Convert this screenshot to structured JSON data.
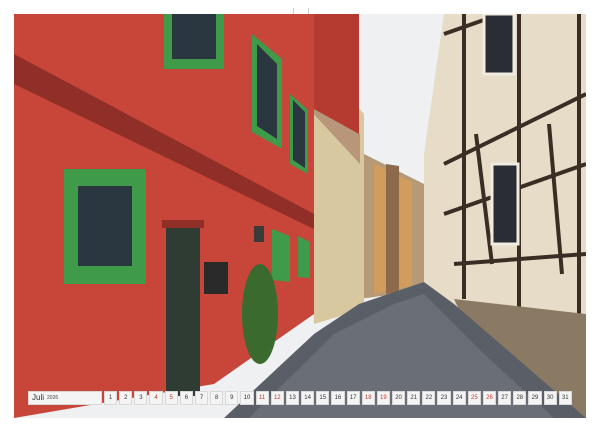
{
  "calendar": {
    "month": "Juli",
    "year": "2026",
    "weekend_color": "#c0392b",
    "days": [
      {
        "n": "1",
        "we": false
      },
      {
        "n": "2",
        "we": false
      },
      {
        "n": "3",
        "we": false
      },
      {
        "n": "4",
        "we": true
      },
      {
        "n": "5",
        "we": true
      },
      {
        "n": "6",
        "we": false
      },
      {
        "n": "7",
        "we": false
      },
      {
        "n": "8",
        "we": false
      },
      {
        "n": "9",
        "we": false
      },
      {
        "n": "10",
        "we": false
      },
      {
        "n": "11",
        "we": true
      },
      {
        "n": "12",
        "we": true
      },
      {
        "n": "13",
        "we": false
      },
      {
        "n": "14",
        "we": false
      },
      {
        "n": "15",
        "we": false
      },
      {
        "n": "16",
        "we": false
      },
      {
        "n": "17",
        "we": false
      },
      {
        "n": "18",
        "we": true
      },
      {
        "n": "19",
        "we": true
      },
      {
        "n": "20",
        "we": false
      },
      {
        "n": "21",
        "we": false
      },
      {
        "n": "22",
        "we": false
      },
      {
        "n": "23",
        "we": false
      },
      {
        "n": "24",
        "we": false
      },
      {
        "n": "25",
        "we": true
      },
      {
        "n": "26",
        "we": true
      },
      {
        "n": "27",
        "we": false
      },
      {
        "n": "28",
        "we": false
      },
      {
        "n": "29",
        "we": false
      },
      {
        "n": "30",
        "we": false
      },
      {
        "n": "31",
        "we": false
      }
    ]
  },
  "colors": {
    "red_wall": "#c8453a",
    "green_frame": "#3f9a4a",
    "cobblestone": "#5a5e66",
    "timber": "#3a2e24",
    "plaster": "#e6dcc8",
    "sky": "#eef0f2"
  }
}
